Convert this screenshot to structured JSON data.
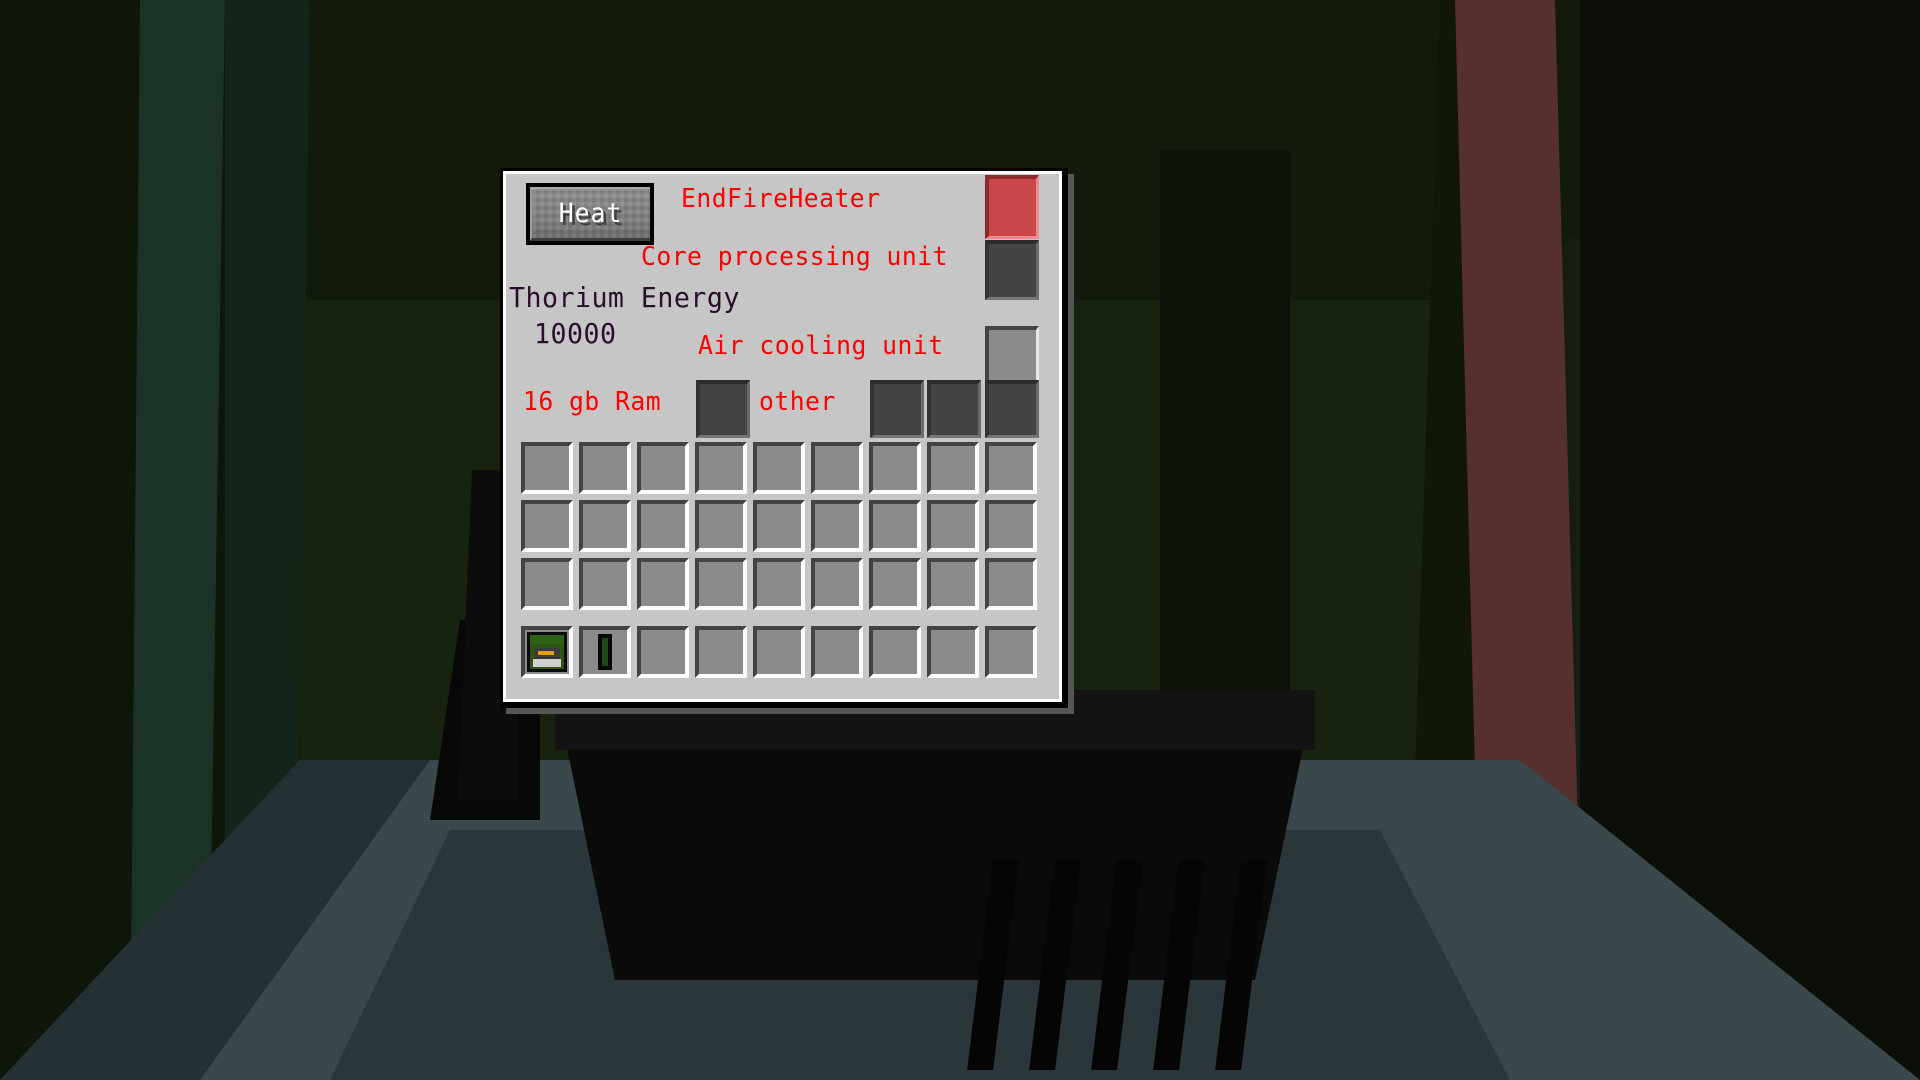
{
  "window": {
    "kind": "minecraft-machine-gui",
    "panel_background": "#c6c6c6",
    "panel_border": "#000000"
  },
  "toolbar": {
    "heat_button_label": "Heat"
  },
  "labels": {
    "title": "EndFireHeater",
    "cpu": "Core processing unit",
    "thorium": "Thorium Energy",
    "thorium_value": "10000",
    "cooling": "Air cooling unit",
    "ram": "16 gb Ram",
    "other": "other"
  },
  "colors": {
    "label_red": "#ff0000",
    "label_purple": "#2b0d2e",
    "heater_slot": "#c9474a",
    "cpu_slot": "#444444",
    "cooling_slot": "#8b8b8b",
    "inventory_slot": "#8b8b8b"
  },
  "machine_slots": [
    {
      "name": "heater-slot",
      "label": "EndFireHeater",
      "state": "filled",
      "color": "#c9474a"
    },
    {
      "name": "cpu-slot",
      "label": "Core processing unit",
      "state": "empty",
      "color": "#444444"
    },
    {
      "name": "cooling-slot",
      "label": "Air cooling unit",
      "state": "empty",
      "color": "#8b8b8b"
    },
    {
      "name": "ram-slot",
      "label": "16 gb Ram",
      "state": "empty",
      "color": "#444444"
    },
    {
      "name": "other-slot-1",
      "label": "other",
      "state": "empty",
      "color": "#444444"
    },
    {
      "name": "other-slot-2",
      "label": "other",
      "state": "empty",
      "color": "#444444"
    },
    {
      "name": "other-slot-3",
      "label": "other",
      "state": "empty",
      "color": "#444444"
    }
  ],
  "inventory": {
    "rows": 3,
    "columns": 9,
    "total_slots": 27,
    "items": []
  },
  "hotbar": {
    "columns": 9,
    "total_slots": 9,
    "items": [
      {
        "index": 0,
        "icon": "computer-case-item",
        "name": "computer-case"
      },
      {
        "index": 1,
        "icon": "ram-stick-item",
        "name": "ram-stick"
      }
    ]
  },
  "scene": {
    "environment": "dark green corridor interior",
    "wall_color": "#17220f",
    "pillar_right_color": "#55302f",
    "floor_color": "#3a474b"
  }
}
